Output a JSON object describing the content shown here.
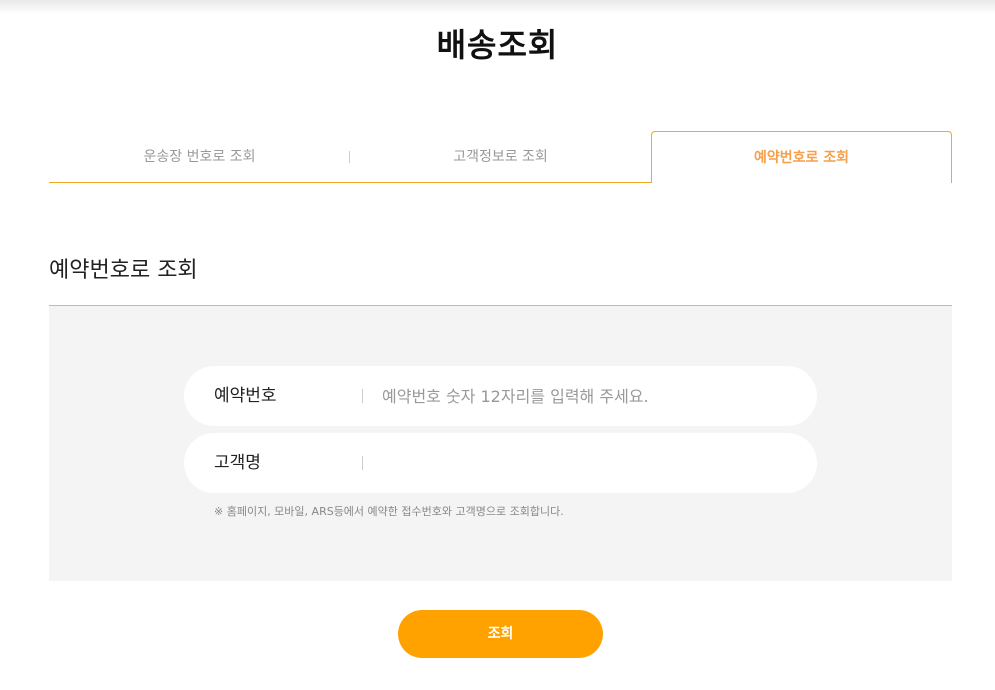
{
  "page": {
    "title": "배송조회"
  },
  "tabs": [
    {
      "label": "운송장 번호로 조회",
      "active": false
    },
    {
      "label": "고객정보로 조회",
      "active": false
    },
    {
      "label": "예약번호로 조회",
      "active": true
    }
  ],
  "section": {
    "title": "예약번호로 조회"
  },
  "form": {
    "reservation": {
      "label": "예약번호",
      "placeholder": "예약번호 숫자 12자리를 입력해 주세요.",
      "value": ""
    },
    "customer": {
      "label": "고객명",
      "placeholder": "",
      "value": ""
    },
    "notice": "※ 홈페이지, 모바일, ARS등에서 예약한 접수번호와 고객명으로 조회합니다."
  },
  "submit": {
    "label": "조회"
  },
  "colors": {
    "accent": "#ffa200",
    "tab_active": "#f5a04a",
    "form_bg": "#f4f4f4"
  }
}
